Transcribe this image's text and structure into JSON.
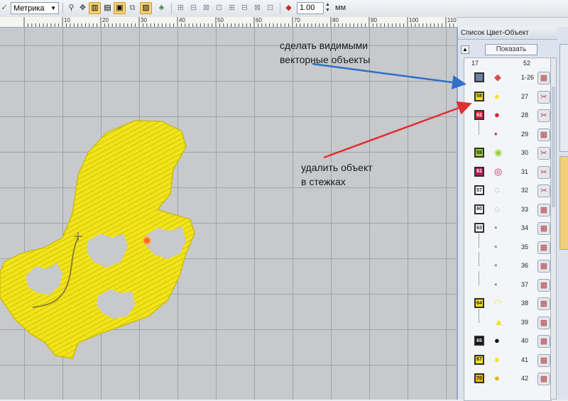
{
  "toolbar": {
    "units_value": "Метрика",
    "stepper_value": "1.00",
    "units_label": "мм"
  },
  "ruler": {
    "ticks": [
      "10",
      "20",
      "30",
      "40",
      "50",
      "60",
      "70",
      "80",
      "90",
      "100",
      "110"
    ]
  },
  "panel": {
    "title": "Список Цвет-Объект",
    "show_button": "Показать",
    "col_left": "17",
    "col_right": "52",
    "rows": [
      {
        "swatch": "",
        "color": "#6e7fa0",
        "thumb": "◆",
        "thumb_color": "#d05050",
        "num": "1-26",
        "action": "▦"
      },
      {
        "swatch": "58",
        "color": "#f2e418",
        "thumb": "●",
        "thumb_color": "#f2e418",
        "num": "27",
        "action": "✂"
      },
      {
        "swatch": "62",
        "color": "#e0203a",
        "thumb": "●",
        "thumb_color": "#e0203a",
        "num": "28",
        "action": "✂"
      },
      {
        "swatch": "",
        "color": "",
        "thumb": "•",
        "thumb_color": "#e0203a",
        "num": "29",
        "action": "▦"
      },
      {
        "swatch": "59",
        "color": "#9acd32",
        "thumb": "◉",
        "thumb_color": "#9acd32",
        "num": "30",
        "action": "✂"
      },
      {
        "swatch": "61",
        "color": "#c2185b",
        "thumb": "◎",
        "thumb_color": "#c2185b",
        "num": "31",
        "action": "✂"
      },
      {
        "swatch": "57",
        "color": "#ffffff",
        "thumb": "◌",
        "thumb_color": "#8a8a8a",
        "num": "32",
        "action": "✂"
      },
      {
        "swatch": "60",
        "color": "#ffffff",
        "thumb": "◌",
        "thumb_color": "#8a8a8a",
        "num": "33",
        "action": "▦"
      },
      {
        "swatch": "63",
        "color": "#ffffff",
        "thumb": "•",
        "thumb_color": "#9a9a9a",
        "num": "34",
        "action": "▦"
      },
      {
        "swatch": "",
        "color": "",
        "thumb": "•",
        "thumb_color": "#9a9a9a",
        "num": "35",
        "action": "▦"
      },
      {
        "swatch": "",
        "color": "",
        "thumb": "•",
        "thumb_color": "#9a9a9a",
        "num": "36",
        "action": "▦"
      },
      {
        "swatch": "",
        "color": "",
        "thumb": "•",
        "thumb_color": "#9a9a9a",
        "num": "37",
        "action": "▦"
      },
      {
        "swatch": "64",
        "color": "#f2e418",
        "thumb": "◠",
        "thumb_color": "#f2e418",
        "num": "38",
        "action": "▦"
      },
      {
        "swatch": "",
        "color": "",
        "thumb": "▲",
        "thumb_color": "#f2e418",
        "num": "39",
        "action": "▦"
      },
      {
        "swatch": "65",
        "color": "#111111",
        "thumb": "●",
        "thumb_color": "#111111",
        "num": "40",
        "action": "▦"
      },
      {
        "swatch": "67",
        "color": "#f2e418",
        "thumb": "●",
        "thumb_color": "#f2e418",
        "num": "41",
        "action": "▦"
      },
      {
        "swatch": "70",
        "color": "#e8b400",
        "thumb": "●",
        "thumb_color": "#e8b400",
        "num": "42",
        "action": "▦"
      }
    ]
  },
  "annotations": {
    "top_line1": "сделать видимыми",
    "top_line2": "векторные объекты",
    "mid_line1": "удалить объект",
    "mid_line2": "в стежках"
  },
  "colors": {
    "embroidery": "#f2e418",
    "arrow_blue": "#2f6fc8",
    "arrow_red": "#e03030"
  }
}
